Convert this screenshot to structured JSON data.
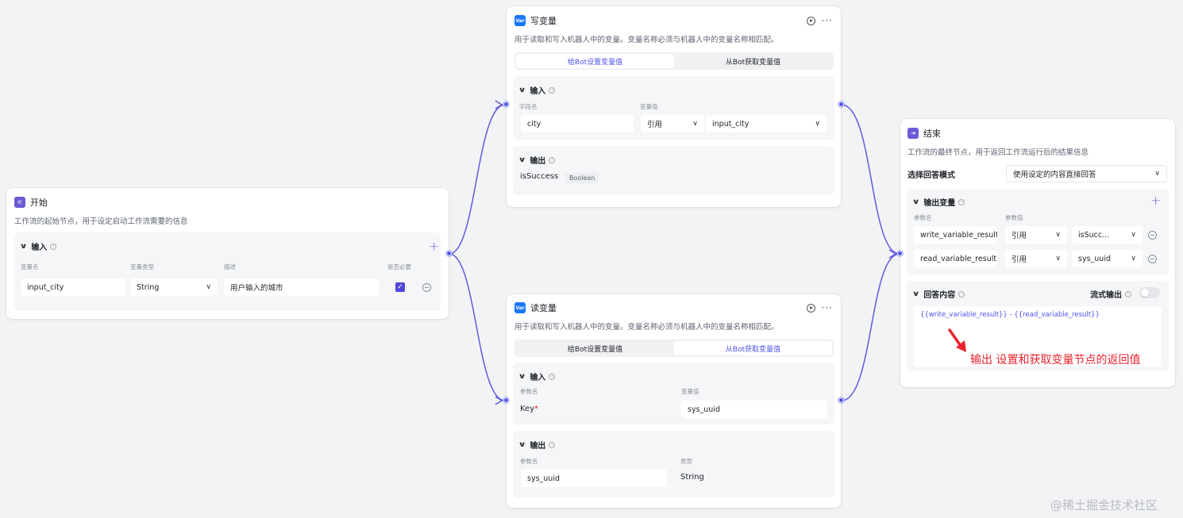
{
  "start_node": {
    "title": "开始",
    "desc": "工作流的起始节点，用于设定启动工作流需要的信息",
    "input_section": "输入",
    "cols": [
      "变量名",
      "变量类型",
      "描述",
      "是否必要"
    ],
    "row": {
      "name": "input_city",
      "type": "String",
      "desc": "用户输入的城市"
    }
  },
  "write_node": {
    "icon": "Var",
    "title": "写变量",
    "desc": "用于读取和写入机器人中的变量。变量名称必须与机器人中的变量名称相匹配。",
    "tabs": [
      "给Bot设置变量值",
      "从Bot获取变量值"
    ],
    "input_section": "输入",
    "cols": [
      "字段名",
      "变量值"
    ],
    "row": {
      "field": "city",
      "mode": "引用",
      "value": "input_city"
    },
    "output_section": "输出",
    "output": {
      "name": "isSuccess",
      "type": "Boolean"
    }
  },
  "read_node": {
    "icon": "Var",
    "title": "读变量",
    "desc": "用于读取和写入机器人中的变量。变量名称必须与机器人中的变量名称相匹配。",
    "tabs": [
      "给Bot设置变量值",
      "从Bot获取变量值"
    ],
    "input_section": "输入",
    "cols": [
      "参数名",
      "变量值"
    ],
    "row": {
      "key": "Key",
      "required_mark": "*",
      "value": "sys_uuid"
    },
    "output_section": "输出",
    "out_cols": [
      "参数名",
      "类型"
    ],
    "output": {
      "name": "sys_uuid",
      "type": "String"
    }
  },
  "end_node": {
    "title": "结束",
    "desc": "工作流的最终节点，用于返回工作流运行后的结果信息",
    "mode_label": "选择回答模式",
    "mode_value": "使用设定的内容直接回答",
    "output_section": "输出变量",
    "cols": [
      "参数名",
      "参数值"
    ],
    "rows": [
      {
        "name": "write_variable_result",
        "mode": "引用",
        "value": "isSucc..."
      },
      {
        "name": "read_variable_result",
        "mode": "引用",
        "value": "sys_uuid"
      }
    ],
    "answer_section": "回答内容",
    "stream_label": "流式输出",
    "answer_text": "{{write_variable_result}} - {{read_variable_result}}"
  },
  "annotation": "输出 设置和获取变量节点的返回值",
  "watermark": "@稀土掘金技术社区",
  "colors": {
    "accent": "#4d53e8",
    "annotation": "#e8232f",
    "brand_purple": "#6b5bd6"
  }
}
